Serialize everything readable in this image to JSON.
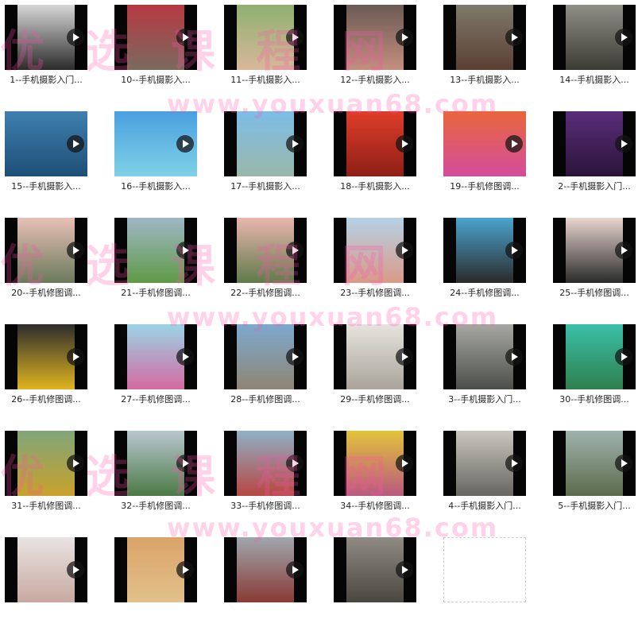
{
  "watermark": {
    "cn_text": "优 选 课 程 网",
    "url_text": "www.youxuan68.com",
    "color": "#ff50aa"
  },
  "videos": [
    {
      "caption": "1--手机摄影入门...",
      "colors": [
        "#d7d7d7",
        "#2b2b2b"
      ]
    },
    {
      "caption": "10--手机摄影入...",
      "colors": [
        "#b73942",
        "#7a6a5f"
      ]
    },
    {
      "caption": "11--手机摄影入...",
      "colors": [
        "#8fb06f",
        "#d8b89a"
      ]
    },
    {
      "caption": "12--手机摄影入...",
      "colors": [
        "#6b5a54",
        "#c48f7f"
      ]
    },
    {
      "caption": "13--手机摄影入...",
      "colors": [
        "#7d7a6b",
        "#5b3f33"
      ]
    },
    {
      "caption": "14--手机摄影入...",
      "colors": [
        "#8f8f86",
        "#3b3b35"
      ]
    },
    {
      "caption": "15--手机摄影入...",
      "colors": [
        "#3f7fb0",
        "#1d4f76"
      ]
    },
    {
      "caption": "16--手机摄影入...",
      "colors": [
        "#4aa0e0",
        "#7fd1e6"
      ]
    },
    {
      "caption": "17--手机摄影入...",
      "colors": [
        "#7dbde8",
        "#9ab8a9"
      ]
    },
    {
      "caption": "18--手机摄影入...",
      "colors": [
        "#e03d2a",
        "#8e1f16"
      ]
    },
    {
      "caption": "19--手机修图调...",
      "colors": [
        "#e8663c",
        "#d34d9c"
      ]
    },
    {
      "caption": "2--手机摄影入门...",
      "colors": [
        "#5a2d7a",
        "#2a1438"
      ]
    },
    {
      "caption": "20--手机修图调...",
      "colors": [
        "#e8c0b5",
        "#6a7a5a"
      ]
    },
    {
      "caption": "21--手机修图调...",
      "colors": [
        "#9fb7c7",
        "#5f9a46"
      ]
    },
    {
      "caption": "22--手机修图调...",
      "colors": [
        "#e9b6ae",
        "#5f7a4a"
      ]
    },
    {
      "caption": "23--手机修图调...",
      "colors": [
        "#b6d1e6",
        "#d99a88"
      ]
    },
    {
      "caption": "24--手机修图调...",
      "colors": [
        "#4aa4cf",
        "#2a2a2a"
      ]
    },
    {
      "caption": "25--手机修图调...",
      "colors": [
        "#e8d5d0",
        "#2a2a2a"
      ]
    },
    {
      "caption": "26--手机修图调...",
      "colors": [
        "#2c2c2c",
        "#e0b51f"
      ]
    },
    {
      "caption": "27--手机修图调...",
      "colors": [
        "#9ad4e6",
        "#d46aa1"
      ]
    },
    {
      "caption": "28--手机修图调...",
      "colors": [
        "#7da9cf",
        "#8f8573"
      ]
    },
    {
      "caption": "29--手机修图调...",
      "colors": [
        "#e7e4df",
        "#a9a39a"
      ]
    },
    {
      "caption": "3--手机摄影入门...",
      "colors": [
        "#a7a8a4",
        "#4c4e4a"
      ]
    },
    {
      "caption": "30--手机修图调...",
      "colors": [
        "#3ac0a8",
        "#2f7f4e"
      ]
    },
    {
      "caption": "31--手机修图调...",
      "colors": [
        "#7fa67a",
        "#c9a12a"
      ]
    },
    {
      "caption": "32--手机修图调...",
      "colors": [
        "#b9c7cf",
        "#4b7a46"
      ]
    },
    {
      "caption": "33--手机修图调...",
      "colors": [
        "#8fb0c7",
        "#b74640"
      ]
    },
    {
      "caption": "34--手机修图调...",
      "colors": [
        "#e2c33a",
        "#b9587f"
      ]
    },
    {
      "caption": "4--手机摄影入门...",
      "colors": [
        "#c9c7c0",
        "#67655f"
      ]
    },
    {
      "caption": "5--手机摄影入门...",
      "colors": [
        "#9fb3ae",
        "#5c6a4a"
      ]
    },
    {
      "caption": "",
      "colors": [
        "#e8e4e2",
        "#c9a8a0"
      ]
    },
    {
      "caption": "",
      "colors": [
        "#d9a46a",
        "#e3c08a"
      ]
    },
    {
      "caption": "",
      "colors": [
        "#9fa7ae",
        "#8a3a34"
      ]
    },
    {
      "caption": "",
      "colors": [
        "#8f8a84",
        "#4a4640"
      ]
    },
    {
      "caption": "",
      "colors": [
        "#ffffff",
        "#ffffff"
      ]
    }
  ]
}
